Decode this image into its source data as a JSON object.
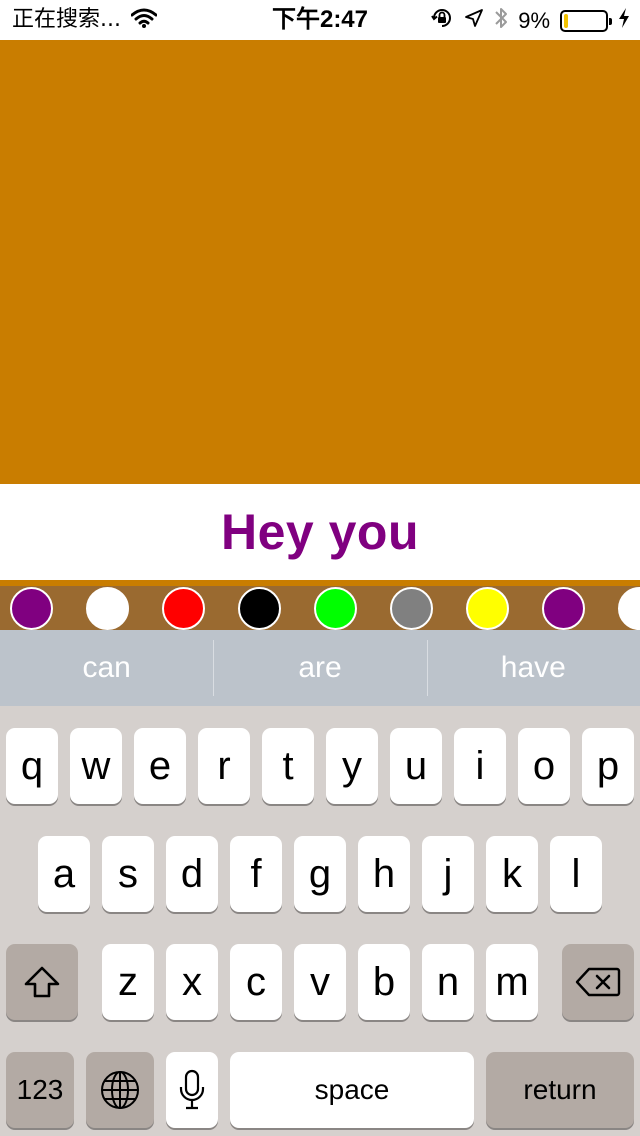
{
  "status_bar": {
    "carrier": "正在搜索...",
    "time": "下午2:47",
    "battery_percent": "9%",
    "battery_level": 0.09,
    "icons": [
      "wifi-icon",
      "orientation-lock-icon",
      "location-arrow-icon",
      "bluetooth-icon",
      "battery-icon",
      "charging-bolt-icon"
    ]
  },
  "canvas": {
    "background_color": "#c97d00"
  },
  "text_area": {
    "text": "Hey you",
    "text_color": "#800080"
  },
  "palette": {
    "background_color": "#9a6a30",
    "swatches": [
      "#800080",
      "#ffffff",
      "#ff0000",
      "#000000",
      "#00ff00",
      "#808080",
      "#ffff00",
      "#800080",
      "#ffffff"
    ]
  },
  "keyboard": {
    "suggestions": [
      "can",
      "are",
      "have"
    ],
    "rows": [
      [
        "q",
        "w",
        "e",
        "r",
        "t",
        "y",
        "u",
        "i",
        "o",
        "p"
      ],
      [
        "a",
        "s",
        "d",
        "f",
        "g",
        "h",
        "j",
        "k",
        "l"
      ],
      [
        "z",
        "x",
        "c",
        "v",
        "b",
        "n",
        "m"
      ]
    ],
    "numbers_label": "123",
    "space_label": "space",
    "return_label": "return"
  }
}
